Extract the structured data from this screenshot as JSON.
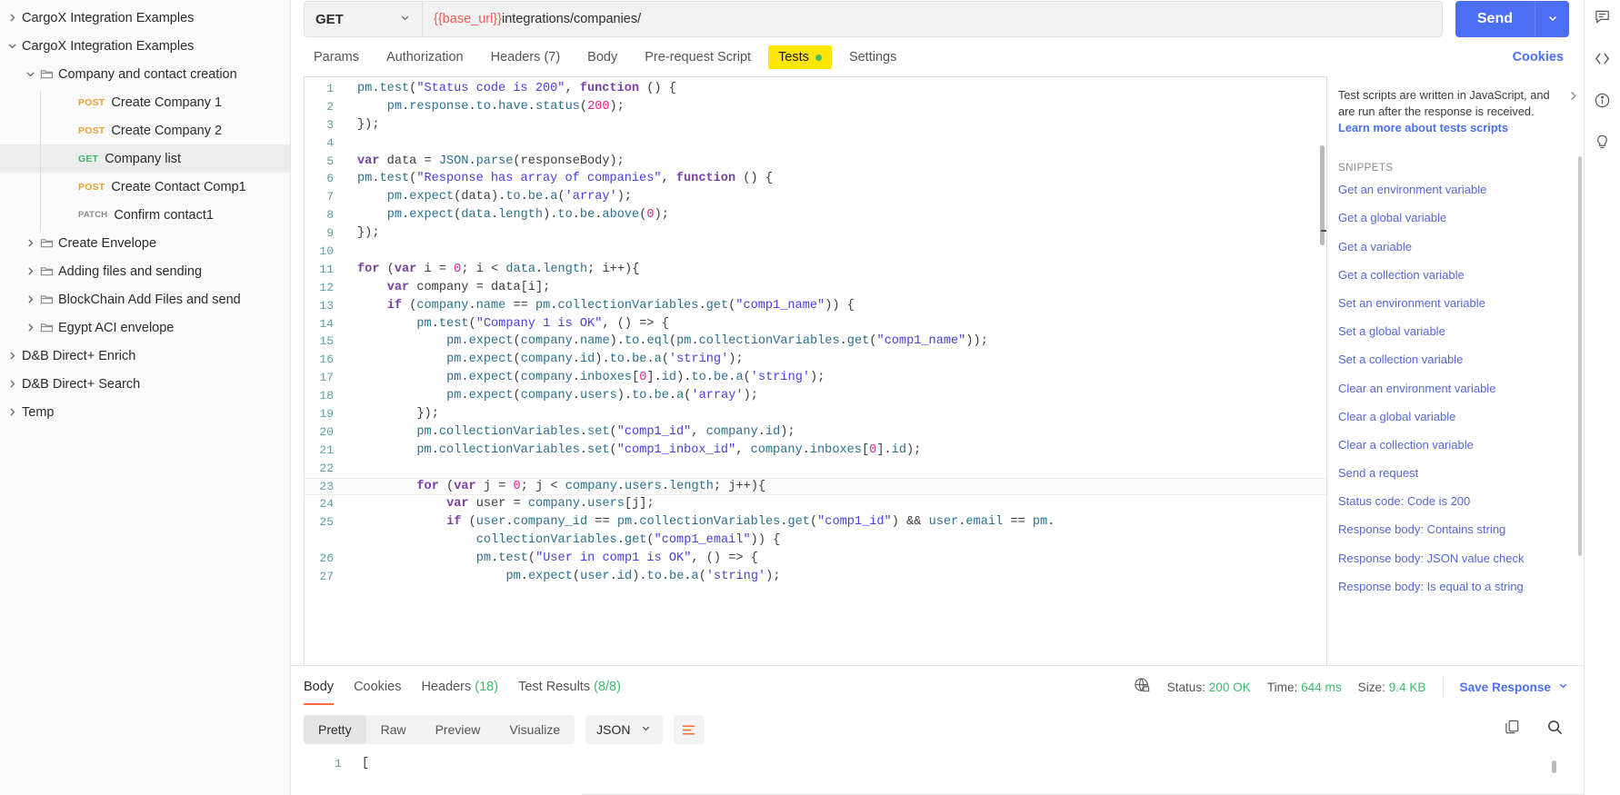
{
  "sidebar": {
    "items": [
      {
        "kind": "collection",
        "label": "CargoX Integration Examples",
        "depth": 0,
        "expanded": false,
        "selected": false
      },
      {
        "kind": "collection",
        "label": "CargoX Integration Examples",
        "depth": 0,
        "expanded": true,
        "selected": false
      },
      {
        "kind": "folder",
        "label": "Company and contact creation",
        "depth": 1,
        "expanded": true,
        "selected": false
      },
      {
        "kind": "request",
        "method": "POST",
        "label": "Create Company 1",
        "depth": 2,
        "selected": false
      },
      {
        "kind": "request",
        "method": "POST",
        "label": "Create Company 2",
        "depth": 2,
        "selected": false
      },
      {
        "kind": "request",
        "method": "GET",
        "label": "Company list",
        "depth": 2,
        "selected": true
      },
      {
        "kind": "request",
        "method": "POST",
        "label": "Create Contact Comp1",
        "depth": 2,
        "selected": false
      },
      {
        "kind": "request",
        "method": "PATCH",
        "label": "Confirm contact1",
        "depth": 2,
        "selected": false
      },
      {
        "kind": "folder",
        "label": "Create Envelope",
        "depth": 1,
        "expanded": false,
        "selected": false
      },
      {
        "kind": "folder",
        "label": "Adding files and sending",
        "depth": 1,
        "expanded": false,
        "selected": false
      },
      {
        "kind": "folder",
        "label": "BlockChain Add Files and send",
        "depth": 1,
        "expanded": false,
        "selected": false
      },
      {
        "kind": "folder",
        "label": "Egypt ACI envelope",
        "depth": 1,
        "expanded": false,
        "selected": false
      },
      {
        "kind": "collection",
        "label": "D&B Direct+ Enrich",
        "depth": 0,
        "expanded": false,
        "selected": false
      },
      {
        "kind": "collection",
        "label": "D&B Direct+ Search",
        "depth": 0,
        "expanded": false,
        "selected": false
      },
      {
        "kind": "collection",
        "label": "Temp",
        "depth": 0,
        "expanded": false,
        "selected": false
      }
    ]
  },
  "request": {
    "method": "GET",
    "url_variable": "{{base_url}}",
    "url_path": "integrations/companies/",
    "send_label": "Send",
    "cookies_label": "Cookies",
    "tabs": [
      {
        "label": "Params",
        "active": false,
        "dot": false
      },
      {
        "label": "Authorization",
        "active": false,
        "dot": false
      },
      {
        "label": "Headers (7)",
        "active": false,
        "dot": false
      },
      {
        "label": "Body",
        "active": false,
        "dot": false
      },
      {
        "label": "Pre-request Script",
        "active": false,
        "dot": false
      },
      {
        "label": "Tests",
        "active": true,
        "dot": true
      },
      {
        "label": "Settings",
        "active": false,
        "dot": false
      }
    ]
  },
  "editor": {
    "lines": [
      {
        "n": "1",
        "code": "pm.test(\"Status code is 200\", function () {"
      },
      {
        "n": "2",
        "code": "    pm.response.to.have.status(200);"
      },
      {
        "n": "3",
        "code": "});"
      },
      {
        "n": "4",
        "code": ""
      },
      {
        "n": "5",
        "code": "var data = JSON.parse(responseBody);"
      },
      {
        "n": "6",
        "code": "pm.test(\"Response has array of companies\", function () {"
      },
      {
        "n": "7",
        "code": "    pm.expect(data).to.be.a('array');"
      },
      {
        "n": "8",
        "code": "    pm.expect(data.length).to.be.above(0);"
      },
      {
        "n": "9",
        "code": "});"
      },
      {
        "n": "10",
        "code": ""
      },
      {
        "n": "11",
        "code": "for (var i = 0; i < data.length; i++){"
      },
      {
        "n": "12",
        "code": "    var company = data[i];"
      },
      {
        "n": "13",
        "code": "    if (company.name == pm.collectionVariables.get(\"comp1_name\")) {"
      },
      {
        "n": "14",
        "code": "        pm.test(\"Company 1 is OK\", () => {"
      },
      {
        "n": "15",
        "code": "            pm.expect(company.name).to.eql(pm.collectionVariables.get(\"comp1_name\"));"
      },
      {
        "n": "16",
        "code": "            pm.expect(company.id).to.be.a('string');"
      },
      {
        "n": "17",
        "code": "            pm.expect(company.inboxes[0].id).to.be.a('string');"
      },
      {
        "n": "18",
        "code": "            pm.expect(company.users).to.be.a('array');"
      },
      {
        "n": "19",
        "code": "        });"
      },
      {
        "n": "20",
        "code": "        pm.collectionVariables.set(\"comp1_id\", company.id);"
      },
      {
        "n": "21",
        "code": "        pm.collectionVariables.set(\"comp1_inbox_id\", company.inboxes[0].id);"
      },
      {
        "n": "22",
        "code": ""
      },
      {
        "n": "23",
        "code": "        for (var j = 0; j < company.users.length; j++){"
      },
      {
        "n": "24",
        "code": "            var user = company.users[j];"
      },
      {
        "n": "25",
        "code": "            if (user.company_id == pm.collectionVariables.get(\"comp1_id\") && user.email == pm."
      },
      {
        "n": "",
        "code": "                collectionVariables.get(\"comp1_email\")) {"
      },
      {
        "n": "26",
        "code": "                pm.test(\"User in comp1 is OK\", () => {"
      },
      {
        "n": "27",
        "code": "                    pm.expect(user.id).to.be.a('string');"
      }
    ]
  },
  "snippets": {
    "description": "Test scripts are written in JavaScript, and are run after the response is received.",
    "learn_more": "Learn more about tests scripts",
    "title": "SNIPPETS",
    "items": [
      "Get an environment variable",
      "Get a global variable",
      "Get a variable",
      "Get a collection variable",
      "Set an environment variable",
      "Set a global variable",
      "Set a collection variable",
      "Clear an environment variable",
      "Clear a global variable",
      "Clear a collection variable",
      "Send a request",
      "Status code: Code is 200",
      "Response body: Contains string",
      "Response body: JSON value check",
      "Response body: Is equal to a string"
    ]
  },
  "response": {
    "tabs": [
      {
        "label": "Body",
        "count": "",
        "active": true
      },
      {
        "label": "Cookies",
        "count": "",
        "active": false
      },
      {
        "label": "Headers",
        "count": "(18)",
        "active": false
      },
      {
        "label": "Test Results",
        "count": "(8/8)",
        "active": false
      }
    ],
    "status_label": "Status:",
    "status_value": "200 OK",
    "time_label": "Time:",
    "time_value": "644 ms",
    "size_label": "Size:",
    "size_value": "9.4 KB",
    "save_response": "Save Response",
    "formats": [
      {
        "label": "Pretty",
        "on": true
      },
      {
        "label": "Raw",
        "on": false
      },
      {
        "label": "Preview",
        "on": false
      },
      {
        "label": "Visualize",
        "on": false
      }
    ],
    "language": "JSON",
    "body_line_number": "1",
    "body_first_line": "["
  },
  "colors": {
    "accent_blue": "#4c6ef5",
    "highlight_yellow": "#ffe600",
    "status_green": "#3dba6b",
    "orange_underline": "#ff6c37",
    "post_orange": "#e8a033"
  }
}
